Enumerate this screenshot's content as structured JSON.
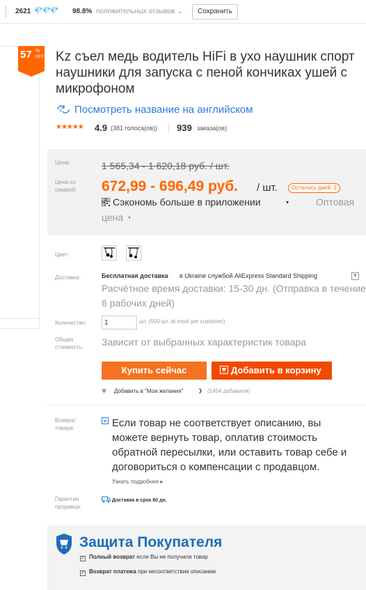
{
  "store_bar": {
    "score": "2621",
    "diamonds": "💎💎💎",
    "positive_percent": "98.8%",
    "positive_label": "положительных отзывов",
    "positive_arrow": "⌄",
    "save_label": "Сохранить"
  },
  "discount": {
    "value": "57",
    "percent_sign": "%",
    "off": "OFF"
  },
  "product": {
    "title": "Kz съел медь водитель HiFi в ухо наушник спорт наушники для запуска с пеной кончиках ушей с микрофоном",
    "translate_link": "Посмотреть название на английском",
    "stars": "★★★★★",
    "rating": "4.9",
    "votes": "(381 голоса(ов))",
    "orders_count": "939",
    "orders_label": "заказа(ов)"
  },
  "price": {
    "price_label": "Цена:",
    "old_price": "1 565,34 - 1 620,18 руб. / шт.",
    "discount_label": "Цена со скидкой:",
    "new_price": "672,99 - 696,49 руб.",
    "per_unit": "/ шт.",
    "days_left": "Осталось дней: 2",
    "app_save": "Сэкономь больше в приложении",
    "wholesale": "Оптовая",
    "price_word": "цена"
  },
  "options": {
    "color_label": "Цвет:",
    "shipping_label": "Доставка:",
    "shipping_free": "Бесплатная доставка",
    "shipping_rest": "в  Ukraine службой AliExpress Standard Shipping",
    "eta": "Расчётное время доставки: 15-30 дн. (Отправка в течение 6 рабочих дней)",
    "quantity_label": "Количество:",
    "quantity_value": "1",
    "quantity_note": "шт. (500 шт. at most per customer)",
    "total_label": "Общая стоимость:",
    "total_value": "Зависит от выбранных характеристик товара"
  },
  "actions": {
    "buy_now": "Купить сейчас",
    "add_to_cart": "Добавить в корзину",
    "wishlist": "Добавить в \"Мои желания\"",
    "wishlist_count": "(1454 добавили)"
  },
  "returns": {
    "label": "Возврат товара:",
    "text_lines": [
      "Если товар не соответствует описанию, вы",
      "можете вернуть товар, оплатив стоимость",
      "обратной пересылки, или оставить товар себе и",
      "договориться о компенсации с продавцом."
    ],
    "more": "Узнать подробнее ▸"
  },
  "guarantee": {
    "label": "Гарантии продавца:",
    "text": "Доставка в срок 60 дн."
  },
  "protection": {
    "title": "Защита Покупателя",
    "line1_bold": "Полный возврат",
    "line1_rest": " если Вы не получили товар",
    "line2_bold": "Возврат платежа",
    "line2_rest": " при несоответствии описанию"
  },
  "colors": {
    "accent": "#ff6600",
    "link": "#2a7ae2",
    "protect_title": "#1c6db8"
  }
}
